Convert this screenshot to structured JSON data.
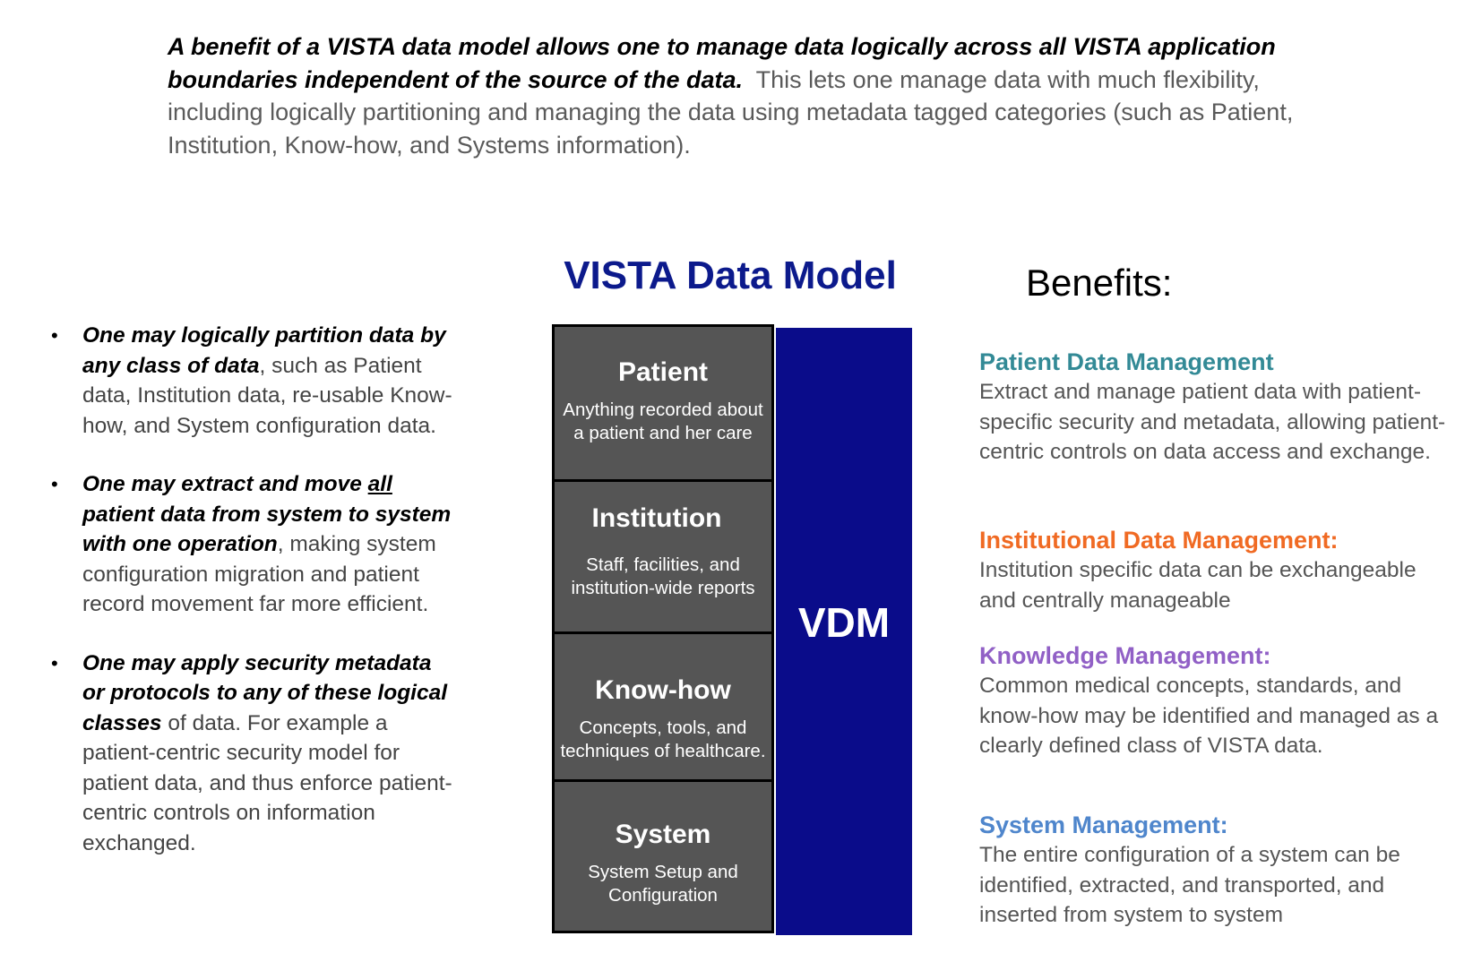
{
  "intro": {
    "lead": "A benefit of a VISTA data model allows one to manage data logically across all VISTA application boundaries independent of the source of the data.",
    "rest": "This lets one manage data with much flexibility, including logically partitioning and managing the data using metadata tagged categories (such as Patient, Institution, Know-how,  and Systems information)."
  },
  "bullets": [
    {
      "bold": "One may logically partition data by any class of data",
      "rest": ", such as Patient data, Institution data,  re-usable Know-how, and System configuration data."
    },
    {
      "bold_a": "One may extract and move ",
      "bold_underlined": "all",
      "bold_b": " patient data from system to system with one operation",
      "rest": ", making system configuration migration and patient record movement far more efficient."
    },
    {
      "bold": "One may apply security metadata or protocols to any of these logical classes",
      "rest": " of data. For example a patient-centric security model for patient data, and thus enforce patient-centric controls on information exchanged."
    }
  ],
  "diagram": {
    "title": "VISTA Data Model",
    "vdm_label": "VDM",
    "layers": [
      {
        "name": "Patient",
        "desc_line1": "Anything recorded about",
        "desc_line2": "a patient and her care"
      },
      {
        "name": "Institution",
        "desc_line1": "Staff, facilities, and",
        "desc_line2": "institution-wide reports"
      },
      {
        "name": "Know-how",
        "desc_line1": "Concepts, tools, and",
        "desc_line2": "techniques of  healthcare."
      },
      {
        "name": "System",
        "desc_line1": "System Setup and",
        "desc_line2": "Configuration"
      }
    ],
    "colors": {
      "layer_fill": "#555555",
      "vdm_fill": "#0a0c8a",
      "title": "#0c1a8c"
    }
  },
  "benefits": {
    "title": "Benefits:",
    "items": [
      {
        "heading": "Patient Data Management",
        "text": "Extract and manage patient data with patient-specific security and metadata, allowing patient-centric controls on data access and exchange.",
        "color": "#338a96"
      },
      {
        "heading": "Institutional Data Management:",
        "text": "Institution specific data can be exchangeable and centrally manageable",
        "color": "#f06a23"
      },
      {
        "heading": "Knowledge Management:",
        "text": "Common medical concepts, standards, and know-how may be identified and managed as a clearly defined class of VISTA data.",
        "color": "#9160c6"
      },
      {
        "heading": "System Management:",
        "text": "The entire configuration of a system can be identified, extracted, and transported, and inserted from system to system",
        "color": "#4f86cc"
      }
    ]
  }
}
